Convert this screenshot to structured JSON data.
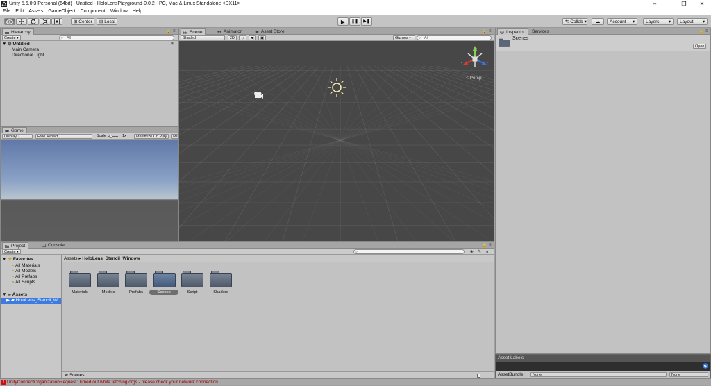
{
  "window": {
    "title": "Unity 5.6.0f3 Personal (64bit) - Untitled - HoloLensPlayground-0.0.2 - PC, Mac & Linux Standalone <DX11>",
    "minimize": "–",
    "maximize": "❐",
    "close": "✕"
  },
  "menu": [
    "File",
    "Edit",
    "Assets",
    "GameObject",
    "Component",
    "Window",
    "Help"
  ],
  "toolbar": {
    "pivot": "Center",
    "space": "Local",
    "collab": "Collab ▾",
    "account": "Account",
    "layers": "Layers",
    "layout": "Layout",
    "play": "▶",
    "pause": "❚❚",
    "step": "▶❚"
  },
  "hierarchy": {
    "tab": "Hierarchy",
    "create": "Create ▾",
    "search_placeholder": "All",
    "scene": "Untitled",
    "items": [
      "Main Camera",
      "Directional Light"
    ]
  },
  "scene_panel": {
    "tabs": [
      "Scene",
      "Animator",
      "Asset Store"
    ],
    "shading": "Shaded",
    "mode_2d": "2D",
    "gizmos": "Gizmos ▾",
    "search_placeholder": "All",
    "persp_label": "< Persp"
  },
  "game_panel": {
    "tab": "Game",
    "display": "Display 1",
    "aspect": "Free Aspect",
    "scale_label": "Scale",
    "scale_value": "1x",
    "maximize_on_play": "Maximize On Play",
    "mute": "Mu"
  },
  "inspector": {
    "tabs": [
      "Inspector",
      "Services"
    ],
    "asset_name": "Scenes",
    "open_button": "Open",
    "asset_labels": "Asset Labels",
    "asset_bundle_label": "AssetBundle",
    "asset_bundle_value": "None",
    "asset_bundle_variant": "None"
  },
  "project": {
    "tabs": [
      "Project",
      "Console"
    ],
    "create": "Create ▾",
    "favorites_label": "Favorites",
    "favorites": [
      "All Materials",
      "All Models",
      "All Prefabs",
      "All Scripts"
    ],
    "assets_label": "Assets",
    "assets_children": [
      "HoloLens_Stencil_W"
    ],
    "breadcrumb": [
      "Assets",
      "HoloLens_Stencil_Window"
    ],
    "folders": [
      "Materials",
      "Models",
      "Prefabs",
      "Scenes",
      "Script",
      "Shaders"
    ],
    "selected_folder": "Scenes",
    "footer_path": "Scenes"
  },
  "status": {
    "message": "UnityConnectOrganizationRequest: Timed out while fetching orgs - please check your network connection"
  },
  "colors": {
    "panel": "#c2c2c2",
    "scene_bg": "#474747",
    "selection": "#3e7be0",
    "error": "#d01010"
  }
}
